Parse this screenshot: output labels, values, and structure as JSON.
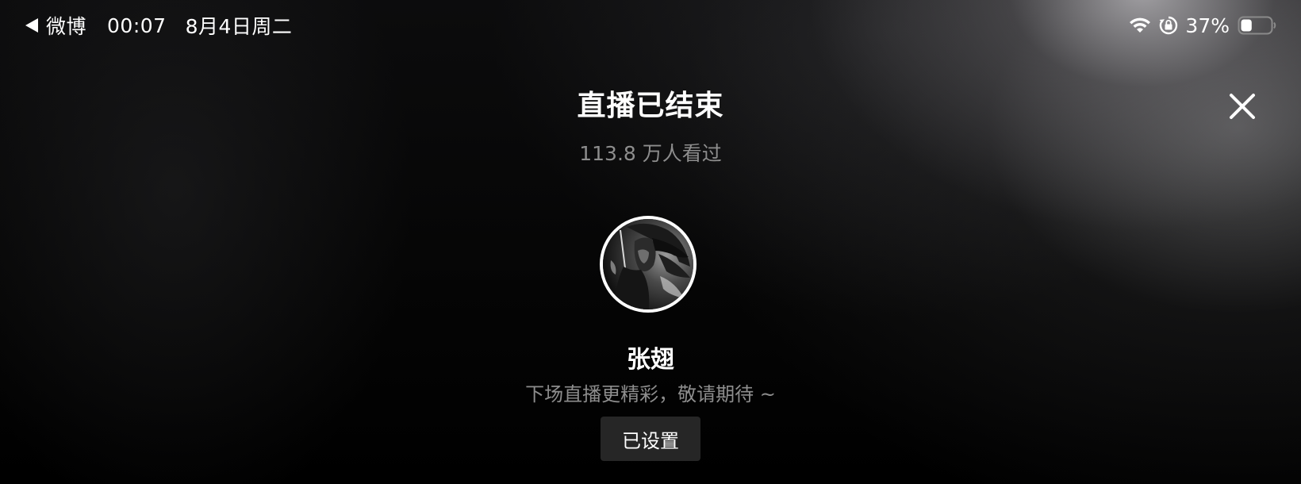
{
  "status_bar": {
    "back_app": "微博",
    "time": "00:07",
    "date": "8月4日周二",
    "battery_percent": "37%",
    "battery_level": 0.37,
    "icons": [
      "back-arrow-icon",
      "wifi-icon",
      "orientation-lock-icon",
      "battery-icon"
    ]
  },
  "live": {
    "title": "直播已结束",
    "viewers": "113.8 万人看过",
    "close_icon": "close-icon"
  },
  "host": {
    "name": "张翅",
    "hint": "下场直播更精彩，敬请期待 ~",
    "button_label": "已设置"
  },
  "colors": {
    "background": "#000000",
    "text_primary": "#ffffff",
    "text_secondary": "#8d8d8d",
    "button_bg": "#262626"
  }
}
